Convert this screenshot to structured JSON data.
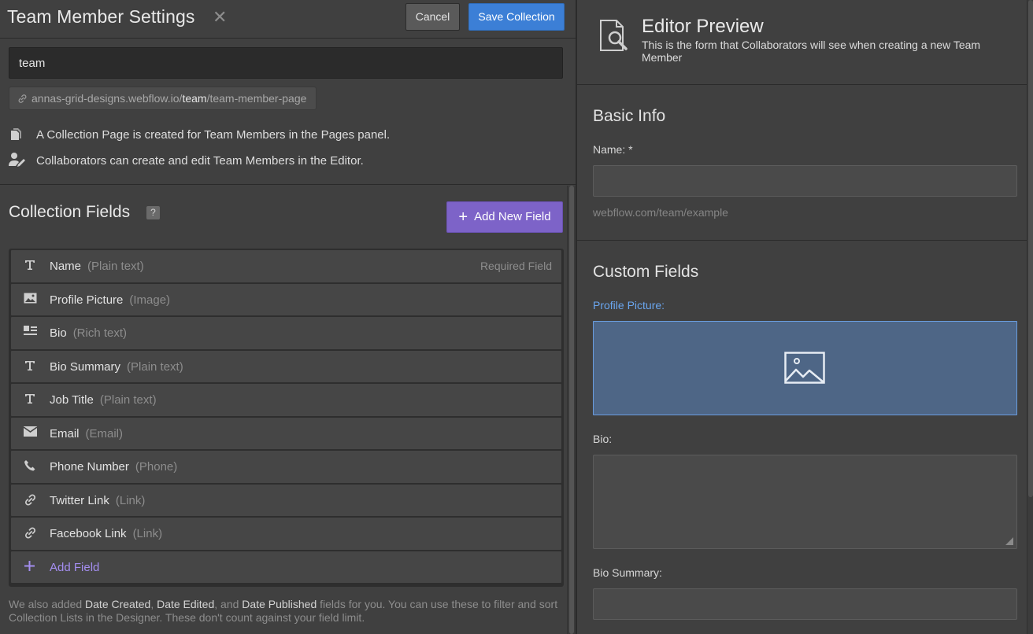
{
  "header": {
    "title": "Team Member Settings",
    "close_glyph": "✕",
    "cancel_label": "Cancel",
    "save_label": "Save Collection"
  },
  "collection": {
    "name_value": "team",
    "slug_url": {
      "prefix": "annas-grid-designs.webflow.io/",
      "slug": "team",
      "suffix": "/team-member-page"
    },
    "info_lines": [
      {
        "icon": "pages-icon",
        "text": "A Collection Page is created for Team Members in the Pages panel."
      },
      {
        "icon": "user-edit-icon",
        "text": "Collaborators can create and edit Team Members in the Editor."
      }
    ]
  },
  "fields_panel": {
    "title": "Collection Fields",
    "help_glyph": "?",
    "add_new_label": "Add New Field",
    "add_glyph": "+",
    "fields": [
      {
        "icon": "text-icon",
        "name": "Name",
        "type": "(Plain text)",
        "required": "Required Field"
      },
      {
        "icon": "image-icon",
        "name": "Profile Picture",
        "type": "(Image)"
      },
      {
        "icon": "rich-text-icon",
        "name": "Bio",
        "type": "(Rich text)"
      },
      {
        "icon": "text-icon",
        "name": "Bio Summary",
        "type": "(Plain text)"
      },
      {
        "icon": "text-icon",
        "name": "Job Title",
        "type": "(Plain text)"
      },
      {
        "icon": "email-icon",
        "name": "Email",
        "type": "(Email)"
      },
      {
        "icon": "phone-icon",
        "name": "Phone Number",
        "type": "(Phone)"
      },
      {
        "icon": "link-icon",
        "name": "Twitter Link",
        "type": "(Link)"
      },
      {
        "icon": "link-icon",
        "name": "Facebook Link",
        "type": "(Link)"
      }
    ],
    "add_field_label": "Add Field",
    "footer": {
      "t1": "We also added ",
      "h1": "Date Created",
      "t2": ", ",
      "h2": "Date Edited",
      "t3": ", and ",
      "h3": "Date Published",
      "t4": " fields for you. You can use these to filter and sort Collection Lists in the Designer. These don't count against your field limit."
    }
  },
  "preview": {
    "title": "Editor Preview",
    "description": "This is the form that Collaborators will see when creating a new Team Member",
    "basic_info_title": "Basic Info",
    "name_label": "Name: *",
    "slug_hint": "webflow.com/team/example",
    "custom_fields_title": "Custom Fields",
    "profile_picture_label": "Profile Picture:",
    "bio_label": "Bio:",
    "bio_summary_label": "Bio Summary:"
  },
  "colors": {
    "accent_blue": "#3c7fd6",
    "accent_purple": "#7d63c8",
    "image_drop_bg": "#4e6686",
    "link_label": "#6aa6ef"
  }
}
